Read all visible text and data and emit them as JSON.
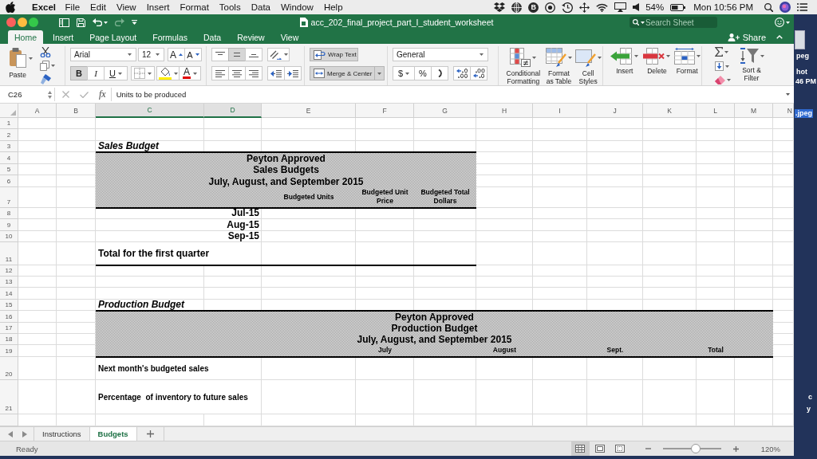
{
  "menubar": {
    "app": "Excel",
    "menus": [
      "File",
      "Edit",
      "View",
      "Insert",
      "Format",
      "Tools",
      "Data",
      "Window",
      "Help"
    ],
    "badge_letter": "B",
    "battery": "54%",
    "clock": "Mon 10:56 PM"
  },
  "window": {
    "title": "acc_202_final_project_part_I_student_worksheet",
    "search": {
      "placeholder": "Search Sheet"
    }
  },
  "tabs": [
    {
      "label": "Home",
      "selected": true
    },
    {
      "label": "Insert",
      "selected": false
    },
    {
      "label": "Page Layout",
      "selected": false
    },
    {
      "label": "Formulas",
      "selected": false
    },
    {
      "label": "Data",
      "selected": false
    },
    {
      "label": "Review",
      "selected": false
    },
    {
      "label": "View",
      "selected": false
    }
  ],
  "share": "Share",
  "ribbon": {
    "paste": "Paste",
    "font": {
      "name": "Arial",
      "size": "12",
      "grow": "A",
      "shrink": "A",
      "styles": [
        {
          "label": "B",
          "kind": "bold",
          "on": true
        },
        {
          "label": "I",
          "kind": "italic",
          "on": false
        },
        {
          "label": "U",
          "kind": "underline",
          "on": false
        }
      ],
      "color_letter": "A"
    },
    "vertical_align": [
      {
        "kind": "top",
        "selected": false
      },
      {
        "kind": "middle",
        "selected": true
      },
      {
        "kind": "bottom",
        "selected": false
      }
    ],
    "wrap_text": {
      "label": "Wrap Text",
      "on": true
    },
    "merge": {
      "label": "Merge & Center",
      "on": true
    },
    "number": {
      "format": "General",
      "currency": "$",
      "percent": "%"
    },
    "styles": [
      "Conditional Formatting",
      "Format as Table",
      "Cell Styles"
    ],
    "cells": [
      "Insert",
      "Delete",
      "Format"
    ],
    "sort": "Sort & Filter"
  },
  "formula_bar": {
    "name_box": "C26",
    "function_label": "fx",
    "formula": "Units to be produced"
  },
  "sheet": {
    "columns": [
      {
        "label": "A",
        "selected": false
      },
      {
        "label": "B",
        "selected": false
      },
      {
        "label": "C",
        "selected": true
      },
      {
        "label": "D",
        "selected": true
      },
      {
        "label": "E",
        "selected": false
      },
      {
        "label": "F",
        "selected": false
      },
      {
        "label": "G",
        "selected": false
      },
      {
        "label": "H",
        "selected": false
      },
      {
        "label": "I",
        "selected": false
      },
      {
        "label": "J",
        "selected": false
      },
      {
        "label": "K",
        "selected": false
      },
      {
        "label": "L",
        "selected": false
      },
      {
        "label": "M",
        "selected": false
      },
      {
        "label": "N",
        "selected": false
      }
    ],
    "rows": [
      "1",
      "2",
      "3",
      "4",
      "5",
      "6",
      "7",
      "8",
      "9",
      "10",
      "11",
      "12",
      "13",
      "14",
      "15",
      "16",
      "17",
      "18",
      "19",
      "20",
      "21"
    ],
    "sales_budget": {
      "title": "Sales Budget",
      "header_lines": [
        "Peyton Approved",
        "Sales Budgets",
        "July, August, and September 2015"
      ],
      "column_heads": [
        "Budgeted Units",
        "Budgeted Unit Price",
        "Budgeted Total Dollars"
      ],
      "months": [
        "Jul-15",
        "Aug-15",
        "Sep-15"
      ],
      "total_label": "Total for the first quarter"
    },
    "production_budget": {
      "title": "Production Budget",
      "header_lines": [
        "Peyton Approved",
        "Production Budget",
        "July, August, and September 2015"
      ],
      "column_heads": [
        "July",
        "August",
        "Sept.",
        "Total"
      ],
      "row_labels": [
        "Next month's budgeted sales",
        "Percentage  of inventory to future sales"
      ]
    }
  },
  "sheet_tabs": [
    {
      "label": "Instructions",
      "selected": false
    },
    {
      "label": "Budgets",
      "selected": true
    }
  ],
  "status_bar": {
    "status": "Ready",
    "views": [
      {
        "kind": "normal",
        "selected": true
      },
      {
        "kind": "page_layout",
        "selected": false
      },
      {
        "kind": "page_break",
        "selected": false
      }
    ],
    "zoom": {
      "level": 0.56,
      "reading": "120%"
    }
  },
  "desktop": {
    "labels": [
      {
        "text": "peg",
        "selected": false
      },
      {
        "text": "hot",
        "selected": false
      },
      {
        "text": "46 PM",
        "selected": false
      },
      {
        "text": ".jpeg",
        "selected": true
      },
      {
        "text": "c",
        "selected": false
      },
      {
        "text": "y",
        "selected": false
      }
    ]
  }
}
